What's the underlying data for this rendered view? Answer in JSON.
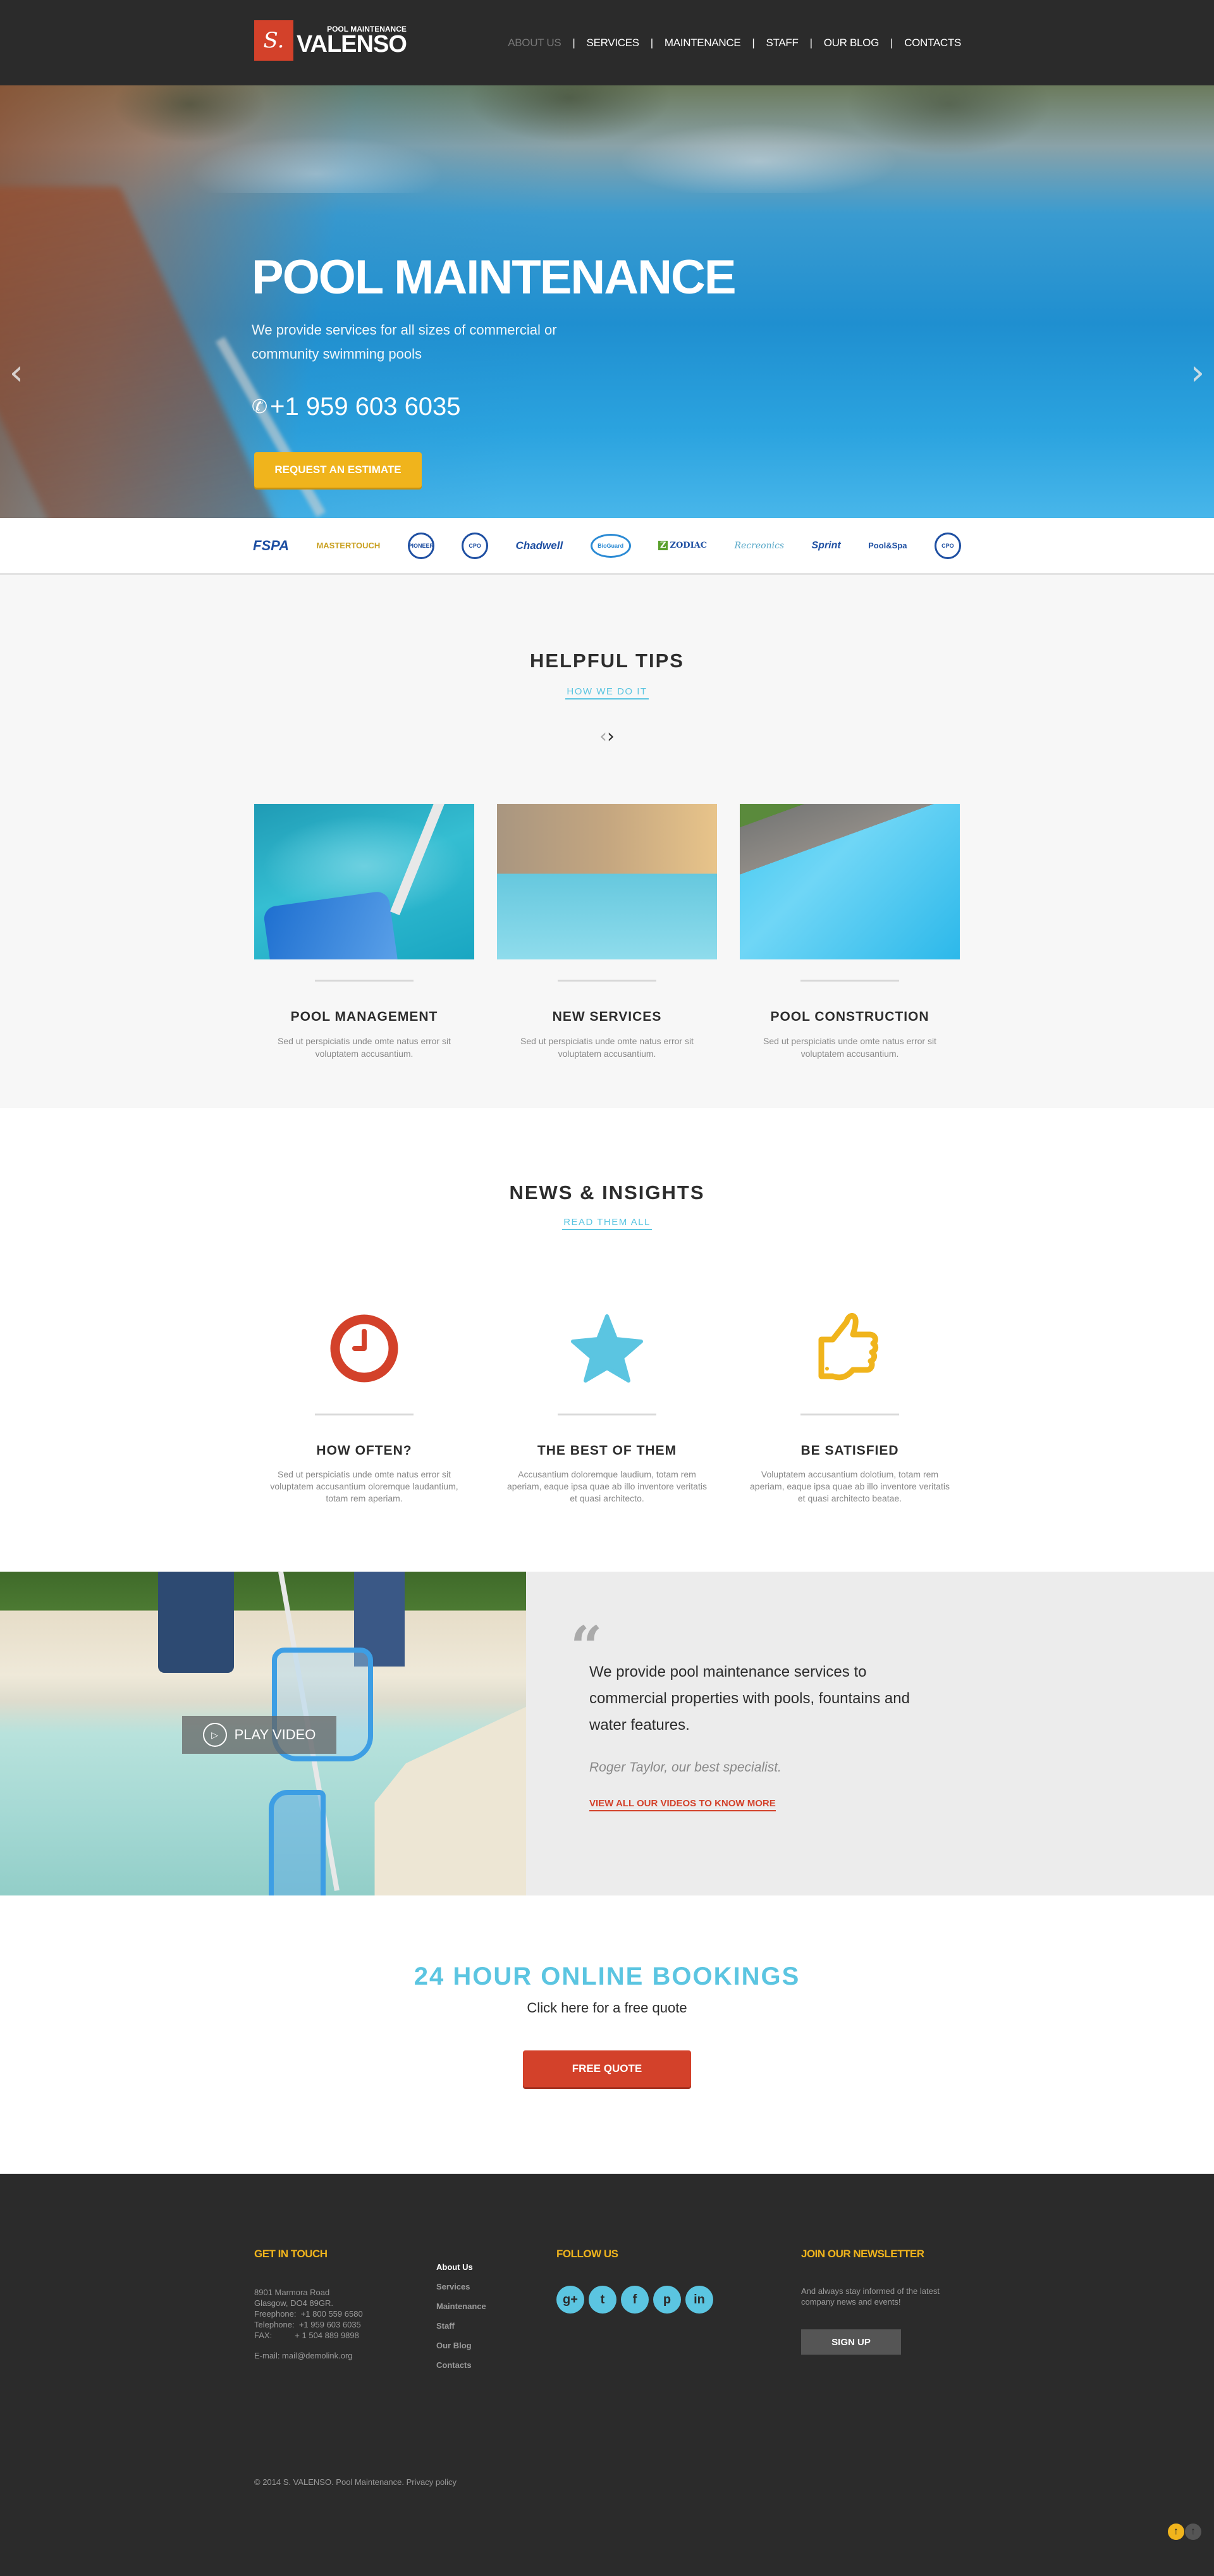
{
  "header": {
    "logo": {
      "mark": "S.",
      "subtitle": "POOL MAINTENANCE",
      "name": "VALENSO"
    },
    "nav": [
      {
        "label": "ABOUT US",
        "active": true
      },
      {
        "label": "SERVICES",
        "active": false
      },
      {
        "label": "MAINTENANCE",
        "active": false
      },
      {
        "label": "STAFF",
        "active": false
      },
      {
        "label": "OUR BLOG",
        "active": false
      },
      {
        "label": "CONTACTS",
        "active": false
      }
    ],
    "separator": "|"
  },
  "hero": {
    "title": "POOL MAINTENANCE",
    "description": "We provide services for all sizes of commercial or community swimming pools",
    "phone_icon": "phone-icon",
    "phone": "+1 959 603 6035",
    "button_label": "REQUEST AN ESTIMATE",
    "prev_arrow": "‹",
    "next_arrow": "›"
  },
  "partners": [
    {
      "name": "FSPA",
      "label": "FSPA"
    },
    {
      "name": "MasterTouch",
      "label": "MASTERTOUCH"
    },
    {
      "name": "Pioneer",
      "label": "PIONEER"
    },
    {
      "name": "CPO",
      "label": "CPO"
    },
    {
      "name": "Chadwell",
      "label": "Chadwell"
    },
    {
      "name": "BioGuard",
      "label": "BioGuard"
    },
    {
      "name": "Zodiac",
      "label": "ZODIAC",
      "mark": "Z"
    },
    {
      "name": "Recreonics",
      "label": "Recreonics"
    },
    {
      "name": "Sprint Aquatics",
      "label": "Sprint"
    },
    {
      "name": "Pool & Spa",
      "label": "Pool&Spa"
    },
    {
      "name": "CPO Instructors",
      "label": "CPO"
    }
  ],
  "tips": {
    "title": "HELPFUL TIPS",
    "link": "HOW WE DO IT",
    "prev": "‹",
    "next": "›",
    "cards": [
      {
        "title": "POOL MANAGEMENT",
        "text": "Sed ut perspiciatis unde omte natus error sit voluptatem accusantium."
      },
      {
        "title": "NEW SERVICES",
        "text": "Sed ut perspiciatis unde omte natus error sit voluptatem accusantium."
      },
      {
        "title": "POOL CONSTRUCTION",
        "text": "Sed ut perspiciatis unde omte natus error sit voluptatem accusantium."
      }
    ]
  },
  "news": {
    "title": "NEWS & INSIGHTS",
    "link": "READ THEM ALL",
    "items": [
      {
        "icon": "clock-icon",
        "color": "#d3412a",
        "title": "HOW OFTEN?",
        "text": "Sed ut perspiciatis unde omte natus error sit voluptatem accusantium oloremque laudantium, totam rem aperiam."
      },
      {
        "icon": "star-icon",
        "color": "#5bc5e1",
        "title": "THE BEST OF THEM",
        "text": "Accusantium doloremque laudium, totam rem aperiam, eaque ipsa quae ab illo inventore veritatis et quasi architecto."
      },
      {
        "icon": "thumbs-up-icon",
        "color": "#f0b41c",
        "title": "BE SATISFIED",
        "text": "Voluptatem accusantium dolotium, totam rem aperiam, eaque ipsa quae ab illo inventore veritatis et quasi architecto beatae."
      }
    ]
  },
  "video": {
    "play_label": "PLAY VIDEO",
    "quote_mark": "“",
    "quote": "We provide pool maintenance services to commercial properties with pools, fountains and water features.",
    "author": "Roger Taylor, our best specialist.",
    "link": "VIEW ALL OUR VIDEOS TO KNOW MORE"
  },
  "bookings": {
    "title": "24 HOUR ONLINE BOOKINGS",
    "subtitle": "Click here for a free quote",
    "button_label": "FREE QUOTE"
  },
  "footer": {
    "contact": {
      "heading": "GET IN TOUCH",
      "address": "8901 Marmora Road\nGlasgow, DO4 89GR.\nFreephone:  +1 800 559 6580\nTelephone:  +1 959 603 6035\nFAX:          + 1 504 889 9898",
      "email": "E-mail: mail@demolink.org"
    },
    "links": [
      {
        "label": "About Us",
        "active": true
      },
      {
        "label": "Services",
        "active": false
      },
      {
        "label": "Maintenance",
        "active": false
      },
      {
        "label": "Staff",
        "active": false
      },
      {
        "label": "Our Blog",
        "active": false
      },
      {
        "label": "Contacts",
        "active": false
      }
    ],
    "follow": {
      "heading": "FOLLOW US",
      "social": [
        {
          "name": "google-plus",
          "glyph": "g+"
        },
        {
          "name": "twitter",
          "glyph": "t"
        },
        {
          "name": "facebook",
          "glyph": "f"
        },
        {
          "name": "pinterest",
          "glyph": "p"
        },
        {
          "name": "linkedin",
          "glyph": "in"
        }
      ]
    },
    "newsletter": {
      "heading": "JOIN OUR NEWSLETTER",
      "text": "And always stay informed of the latest company news and events!",
      "button_label": "SIGN UP"
    },
    "copyright": "© 2014 S. VALENSO. Pool Maintenance. Privacy policy",
    "to_top": "↑"
  },
  "colors": {
    "accent_red": "#d3412a",
    "accent_blue": "#5bc5e1",
    "accent_yellow": "#f0b41c",
    "dark": "#2b2b2b"
  }
}
